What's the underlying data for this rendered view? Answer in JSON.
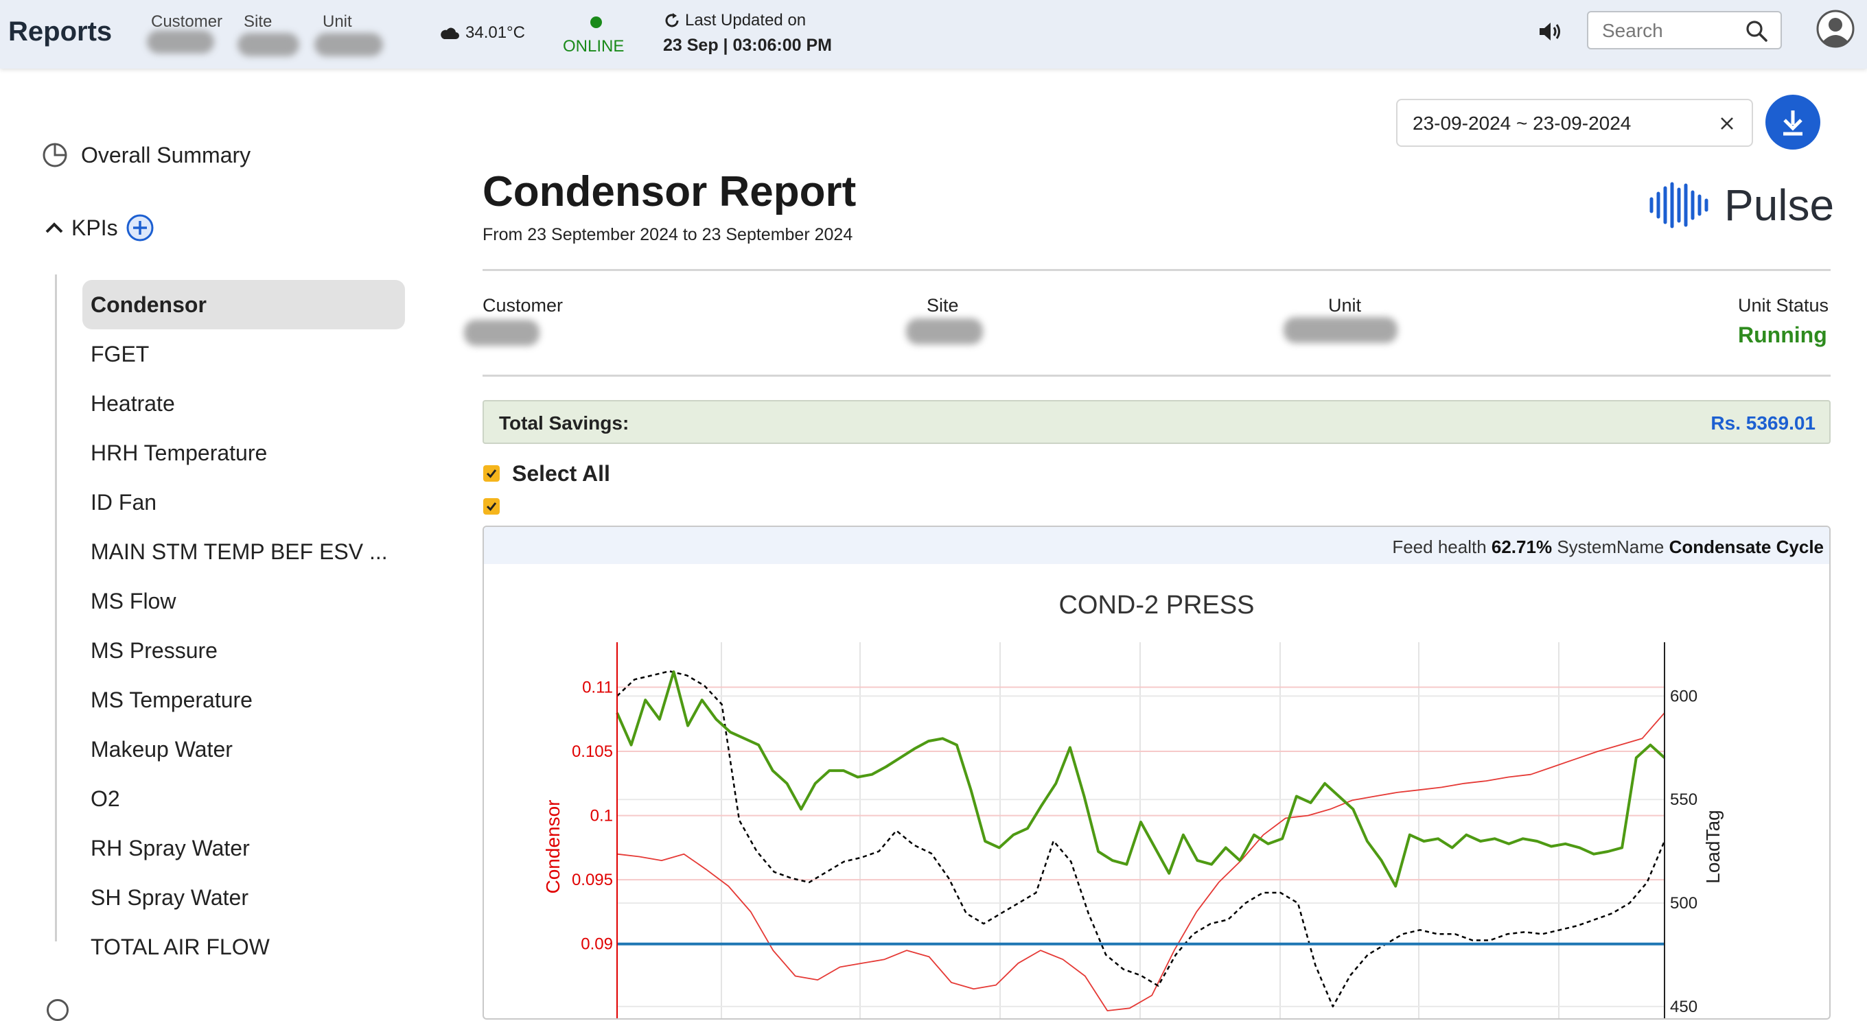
{
  "header": {
    "brand": "Reports",
    "labels": {
      "customer": "Customer",
      "site": "Site",
      "unit": "Unit"
    },
    "weather": "34.01°C",
    "status": "ONLINE",
    "last_updated_label": "Last Updated on",
    "last_updated_value": "23 Sep | 03:06:00 PM",
    "search_placeholder": "Search"
  },
  "sidebar": {
    "overall_summary": "Overall Summary",
    "kpis_label": "KPIs",
    "items": [
      "Condensor",
      "FGET",
      "Heatrate",
      "HRH Temperature",
      "ID Fan",
      "MAIN STM TEMP BEF ESV ...",
      "MS Flow",
      "MS Pressure",
      "MS Temperature",
      "Makeup Water",
      "O2",
      "RH Spray Water",
      "SH Spray Water",
      "TOTAL AIR FLOW"
    ],
    "active_item": "Condensor"
  },
  "main": {
    "date_range": "23-09-2024 ~ 23-09-2024",
    "title": "Condensor Report",
    "subtitle": "From 23 September 2024 to 23 September 2024",
    "logo_text": "Pulse",
    "info": {
      "customer_label": "Customer",
      "site_label": "Site",
      "unit_label": "Unit",
      "unit_status_label": "Unit Status",
      "unit_status_value": "Running"
    },
    "savings_label": "Total Savings:",
    "savings_value": "Rs. 5369.01",
    "select_all": "Select All",
    "card": {
      "feed_health_label": "Feed health",
      "feed_health_value": "62.71%",
      "system_name_label": "SystemName",
      "system_name_value": "Condensate Cycle"
    }
  },
  "colors": {
    "accent_blue": "#1c5fd1",
    "online_green": "#1a8a1a",
    "running_green": "#2e8b1e",
    "checkbox": "#f5b51c"
  },
  "chart_data": {
    "type": "line",
    "title": "COND-2 PRESS",
    "ylabel_left": "Condensor",
    "ylabel_right": "LoadTag",
    "y_left_ticks": [
      0.09,
      0.095,
      0.1,
      0.105,
      0.11
    ],
    "y_left_range": [
      0.084,
      0.1135
    ],
    "y_right_ticks": [
      450,
      500,
      550,
      600
    ],
    "y_right_range": [
      443,
      626
    ],
    "grid": true,
    "series": [
      {
        "color": "#4e9a13",
        "axis": "left",
        "values": [
          0.108,
          0.1055,
          0.109,
          0.1075,
          0.1112,
          0.107,
          0.109,
          0.1075,
          0.1065,
          0.106,
          0.1055,
          0.1035,
          0.1025,
          0.1005,
          0.1025,
          0.1035,
          0.1035,
          0.103,
          0.1032,
          0.1038,
          0.1045,
          0.1052,
          0.1058,
          0.106,
          0.1055,
          0.102,
          0.098,
          0.0975,
          0.0985,
          0.099,
          0.1008,
          0.1025,
          0.1053,
          0.1015,
          0.0972,
          0.0965,
          0.0962,
          0.0995,
          0.0975,
          0.0955,
          0.0985,
          0.0965,
          0.0962,
          0.0975,
          0.0965,
          0.0985,
          0.0978,
          0.0982,
          0.1015,
          0.101,
          0.1025,
          0.1015,
          0.1005,
          0.098,
          0.0965,
          0.0945,
          0.0985,
          0.098,
          0.0982,
          0.0975,
          0.0985,
          0.098,
          0.0982,
          0.0978,
          0.0982,
          0.098,
          0.0976,
          0.0978,
          0.0975,
          0.097,
          0.0972,
          0.0975,
          0.1045,
          0.1055,
          0.1045
        ]
      },
      {
        "color": "#000000",
        "axis": "right",
        "dashed": true,
        "values": [
          600,
          608,
          610,
          612,
          610,
          605,
          596,
          540,
          525,
          515,
          512,
          510,
          515,
          520,
          522,
          525,
          535,
          528,
          524,
          512,
          495,
          490,
          495,
          500,
          505,
          530,
          520,
          495,
          475,
          468,
          465,
          460,
          475,
          485,
          490,
          492,
          500,
          505,
          505,
          500,
          470,
          450,
          465,
          475,
          480,
          485,
          487,
          485,
          485,
          482,
          482,
          485,
          486,
          485,
          487,
          489,
          492,
          495,
          500,
          510,
          530
        ]
      },
      {
        "color": "#e53935",
        "axis": "left",
        "values": [
          0.097,
          0.0968,
          0.0965,
          0.097,
          0.0958,
          0.0945,
          0.0925,
          0.0895,
          0.0875,
          0.0872,
          0.0882,
          0.0885,
          0.0888,
          0.0895,
          0.089,
          0.087,
          0.0865,
          0.0868,
          0.0885,
          0.0895,
          0.0888,
          0.0875,
          0.0848,
          0.085,
          0.086,
          0.0895,
          0.0925,
          0.0948,
          0.0965,
          0.0985,
          0.0998,
          0.1,
          0.1005,
          0.1012,
          0.1015,
          0.1018,
          0.102,
          0.1022,
          0.1025,
          0.1027,
          0.103,
          0.1032,
          0.1038,
          0.1044,
          0.105,
          0.1055,
          0.106,
          0.108
        ]
      },
      {
        "color": "#1f77b4",
        "axis": "left",
        "values": [
          0.09,
          0.09
        ]
      }
    ]
  }
}
